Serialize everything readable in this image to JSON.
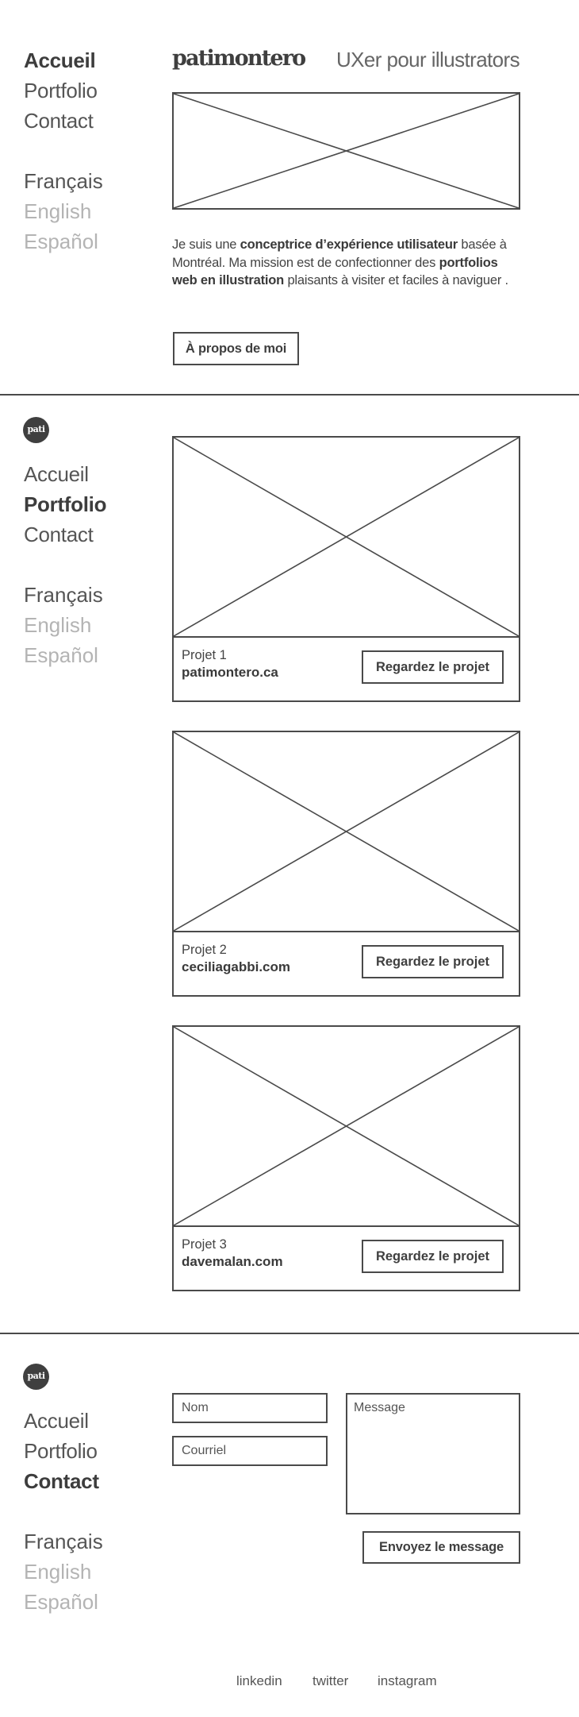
{
  "home": {
    "nav": [
      {
        "label": "Accueil",
        "active": true
      },
      {
        "label": "Portfolio",
        "active": false
      },
      {
        "label": "Contact",
        "active": false
      }
    ],
    "languages": [
      {
        "label": "Français",
        "active": true
      },
      {
        "label": "English",
        "active": false
      },
      {
        "label": "Español",
        "active": false
      }
    ],
    "wordmark": "patimontero",
    "tagline": "UXer pour illustrators",
    "intro": {
      "p1": "Je suis une ",
      "b1": "conceptrice d’expérience utilisateur",
      "p2": " basée à Montréal. Ma mission est de confectionner des ",
      "b2": "portfolios web en illustration",
      "p3": " plaisants à visiter et faciles à naviguer ."
    },
    "about_button": "À propos de moi"
  },
  "portfolio": {
    "logo_text": "pati",
    "nav": [
      {
        "label": "Accueil",
        "active": false
      },
      {
        "label": "Portfolio",
        "active": true
      },
      {
        "label": "Contact",
        "active": false
      }
    ],
    "languages": [
      {
        "label": "Français",
        "active": true
      },
      {
        "label": "English",
        "active": false
      },
      {
        "label": "Español",
        "active": false
      }
    ],
    "projects": [
      {
        "label": "Projet 1",
        "site": "patimontero.ca",
        "button": "Regardez le projet"
      },
      {
        "label": "Projet 2",
        "site": "ceciliagabbi.com",
        "button": "Regardez le projet"
      },
      {
        "label": "Projet 3",
        "site": "davemalan.com",
        "button": "Regardez le projet"
      }
    ]
  },
  "contact": {
    "logo_text": "pati",
    "nav": [
      {
        "label": "Accueil",
        "active": false
      },
      {
        "label": "Portfolio",
        "active": false
      },
      {
        "label": "Contact",
        "active": true
      }
    ],
    "languages": [
      {
        "label": "Français",
        "active": true
      },
      {
        "label": "English",
        "active": false
      },
      {
        "label": "Español",
        "active": false
      }
    ],
    "form": {
      "name_placeholder": "Nom",
      "email_placeholder": "Courriel",
      "message_placeholder": "Message",
      "submit_label": "Envoyez le message"
    }
  },
  "footer": {
    "links": [
      "linkedin",
      "twitter",
      "instagram"
    ]
  },
  "colors": {
    "stroke": "#4a4a4a",
    "text": "#3f3f3f",
    "muted": "#b4b4b4",
    "background": "#ffffff"
  }
}
